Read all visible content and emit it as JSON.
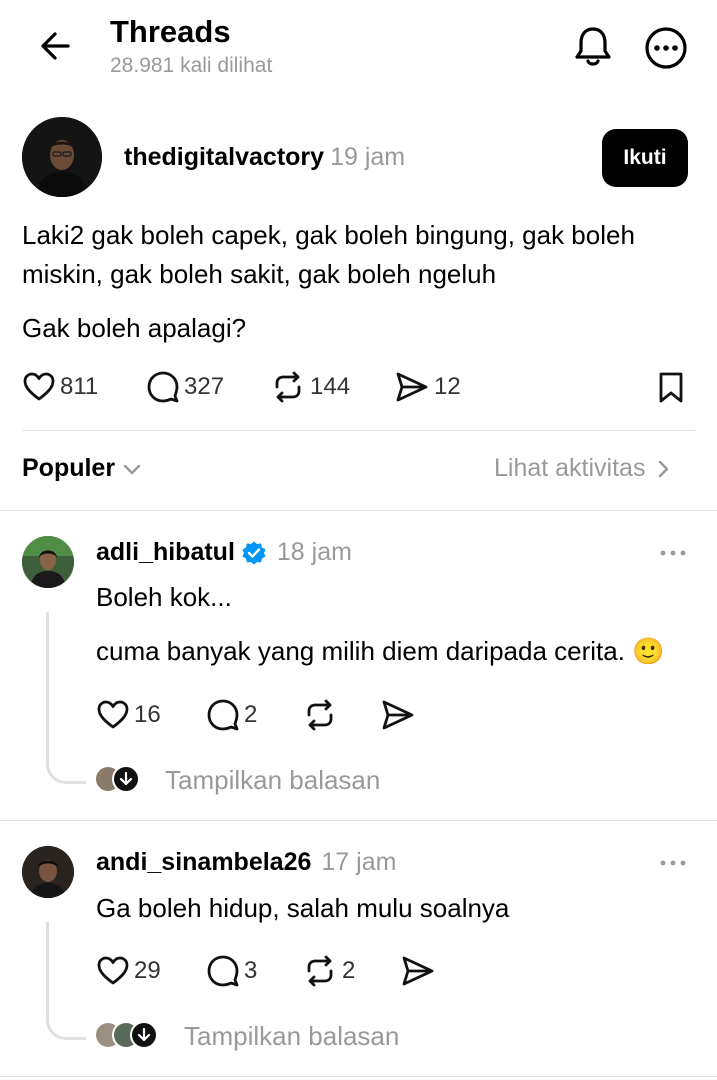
{
  "header": {
    "title": "Threads",
    "views": "28.981 kali dilihat"
  },
  "post": {
    "username": "thedigitalvactory",
    "time": "19 jam",
    "follow_label": "Ikuti",
    "text_line1": "Laki2 gak boleh capek, gak boleh bingung, gak boleh",
    "text_line2": "miskin, gak boleh sakit, gak boleh ngeluh",
    "text_para2": "Gak boleh apalagi?",
    "likes": "811",
    "comments": "327",
    "reposts": "144",
    "shares": "12"
  },
  "sort": {
    "label": "Populer",
    "activity_link": "Lihat aktivitas"
  },
  "replies": [
    {
      "username": "adli_hibatul",
      "verified": true,
      "time": "18 jam",
      "line1": "Boleh kok...",
      "line2": "cuma banyak yang milih diem daripada cerita. 🙂",
      "likes": "16",
      "comments": "2",
      "reposts": "",
      "show_replies": "Tampilkan balasan"
    },
    {
      "username": "andi_sinambela26",
      "verified": false,
      "time": "17 jam",
      "line1": "Ga boleh hidup, salah mulu soalnya",
      "likes": "29",
      "comments": "3",
      "reposts": "2",
      "show_replies": "Tampilkan balasan"
    }
  ],
  "colors": {
    "muted": "#999999",
    "verified": "#0095f6",
    "button_bg": "#000000"
  }
}
